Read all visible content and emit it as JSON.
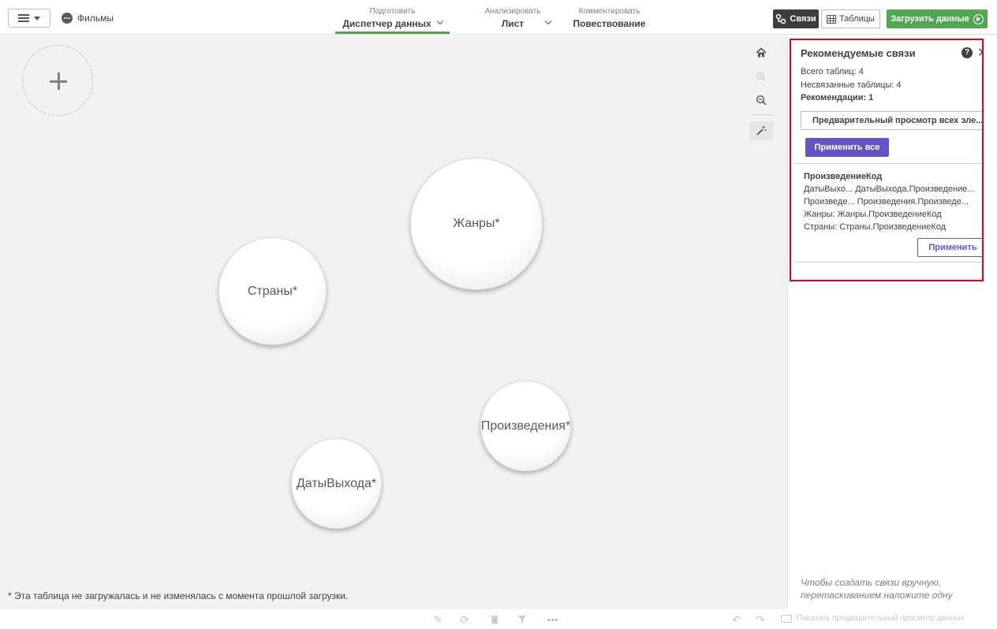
{
  "header": {
    "app_name": "Фильмы",
    "nav": [
      {
        "small": "Подготовить",
        "big": "Диспетчер данных"
      },
      {
        "small": "Анализировать",
        "big": "Лист"
      },
      {
        "small": "Комментировать",
        "big": "Повествование"
      }
    ],
    "links_label": "Связи",
    "tables_label": "Таблицы",
    "load_label": "Загрузить данные",
    "colors": {
      "accent_green": "#52a552",
      "dark_button": "#3d3d3d"
    }
  },
  "canvas": {
    "tables": [
      {
        "name": "Жанры*"
      },
      {
        "name": "Страны*"
      },
      {
        "name": "Произведения*"
      },
      {
        "name": "ДатыВыхода*"
      }
    ],
    "footnote": "* Эта таблица не загружалась и не изменялась с момента прошлой загрузки.",
    "tools": [
      "home-icon",
      "zoom-in-icon",
      "zoom-out-icon",
      "magic-wand-icon"
    ]
  },
  "recommendations": {
    "title": "Рекомендуемые связи",
    "stats": {
      "total": "Всего таблиц: 4",
      "unlinked": "Несвязанные таблицы: 4",
      "recs": "Рекомендации: 1"
    },
    "preview_all_label": "Предварительный просмотр всех эле...",
    "apply_all_label": "Применить все",
    "card": {
      "title": "ПроизведениеКод",
      "lines": [
        "ДатыВыхо... ДатыВыхода.Произведение...",
        "Произведе... Произведения.Произведе...",
        "Жанры: Жанры.ПроизведениеКод",
        "Страны: Страны.ПроизведениеКод"
      ],
      "apply_label": "Применить"
    },
    "hint": "Чтобы создать связи вручную, перетаскиванием наложите одну",
    "colors": {
      "highlight_border": "#e0001b",
      "primary": "#6553c8"
    }
  },
  "bottombar": {
    "more_label": "···",
    "preview_data_label": "Показать предварительный просмотр данных"
  }
}
